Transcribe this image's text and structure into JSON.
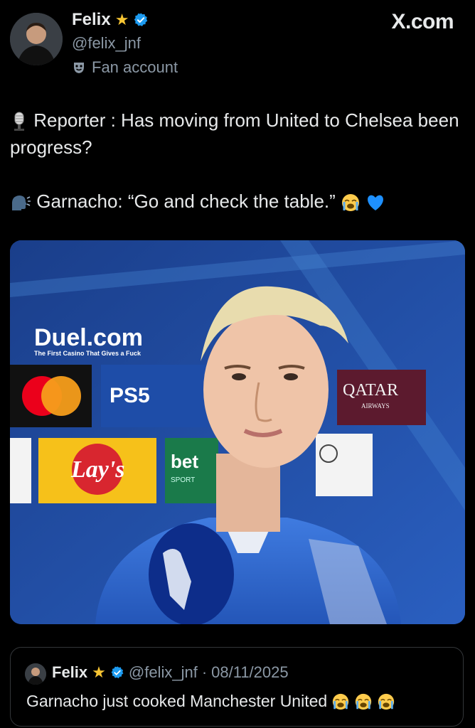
{
  "header": {
    "name": "Felix",
    "handle": "@felix_jnf",
    "fan_label": "Fan account",
    "brand": "X.com"
  },
  "tweet": {
    "line1_prefix_icon": "microphone-icon",
    "line1": "Reporter : Has moving from United to Chelsea been progress?",
    "line2_prefix_icon": "speaking-head-icon",
    "line2": "Garnacho: “Go and check the table.”",
    "line2_emojis": [
      "crying-face",
      "blue-heart"
    ]
  },
  "media": {
    "sponsor_logo": "Duel.com",
    "sponsor_tagline": "The First Casino That Gives a Fuck",
    "boards": [
      "PS5",
      "QATAR",
      "AIRWAYS",
      "Lay's",
      "bet",
      "SPORT"
    ]
  },
  "quote": {
    "name": "Felix",
    "handle": "@felix_jnf",
    "separator": "·",
    "date": "08/11/2025",
    "text": "Garnacho just cooked Manchester United",
    "emojis": [
      "crying-face",
      "crying-face",
      "crying-face"
    ]
  },
  "colors": {
    "background": "#000000",
    "text": "#e7e9ea",
    "muted": "#8b98a5",
    "verified": "#1d9bf0",
    "star": "#f7c533",
    "chelsea_blue": "#1d4fa7"
  }
}
